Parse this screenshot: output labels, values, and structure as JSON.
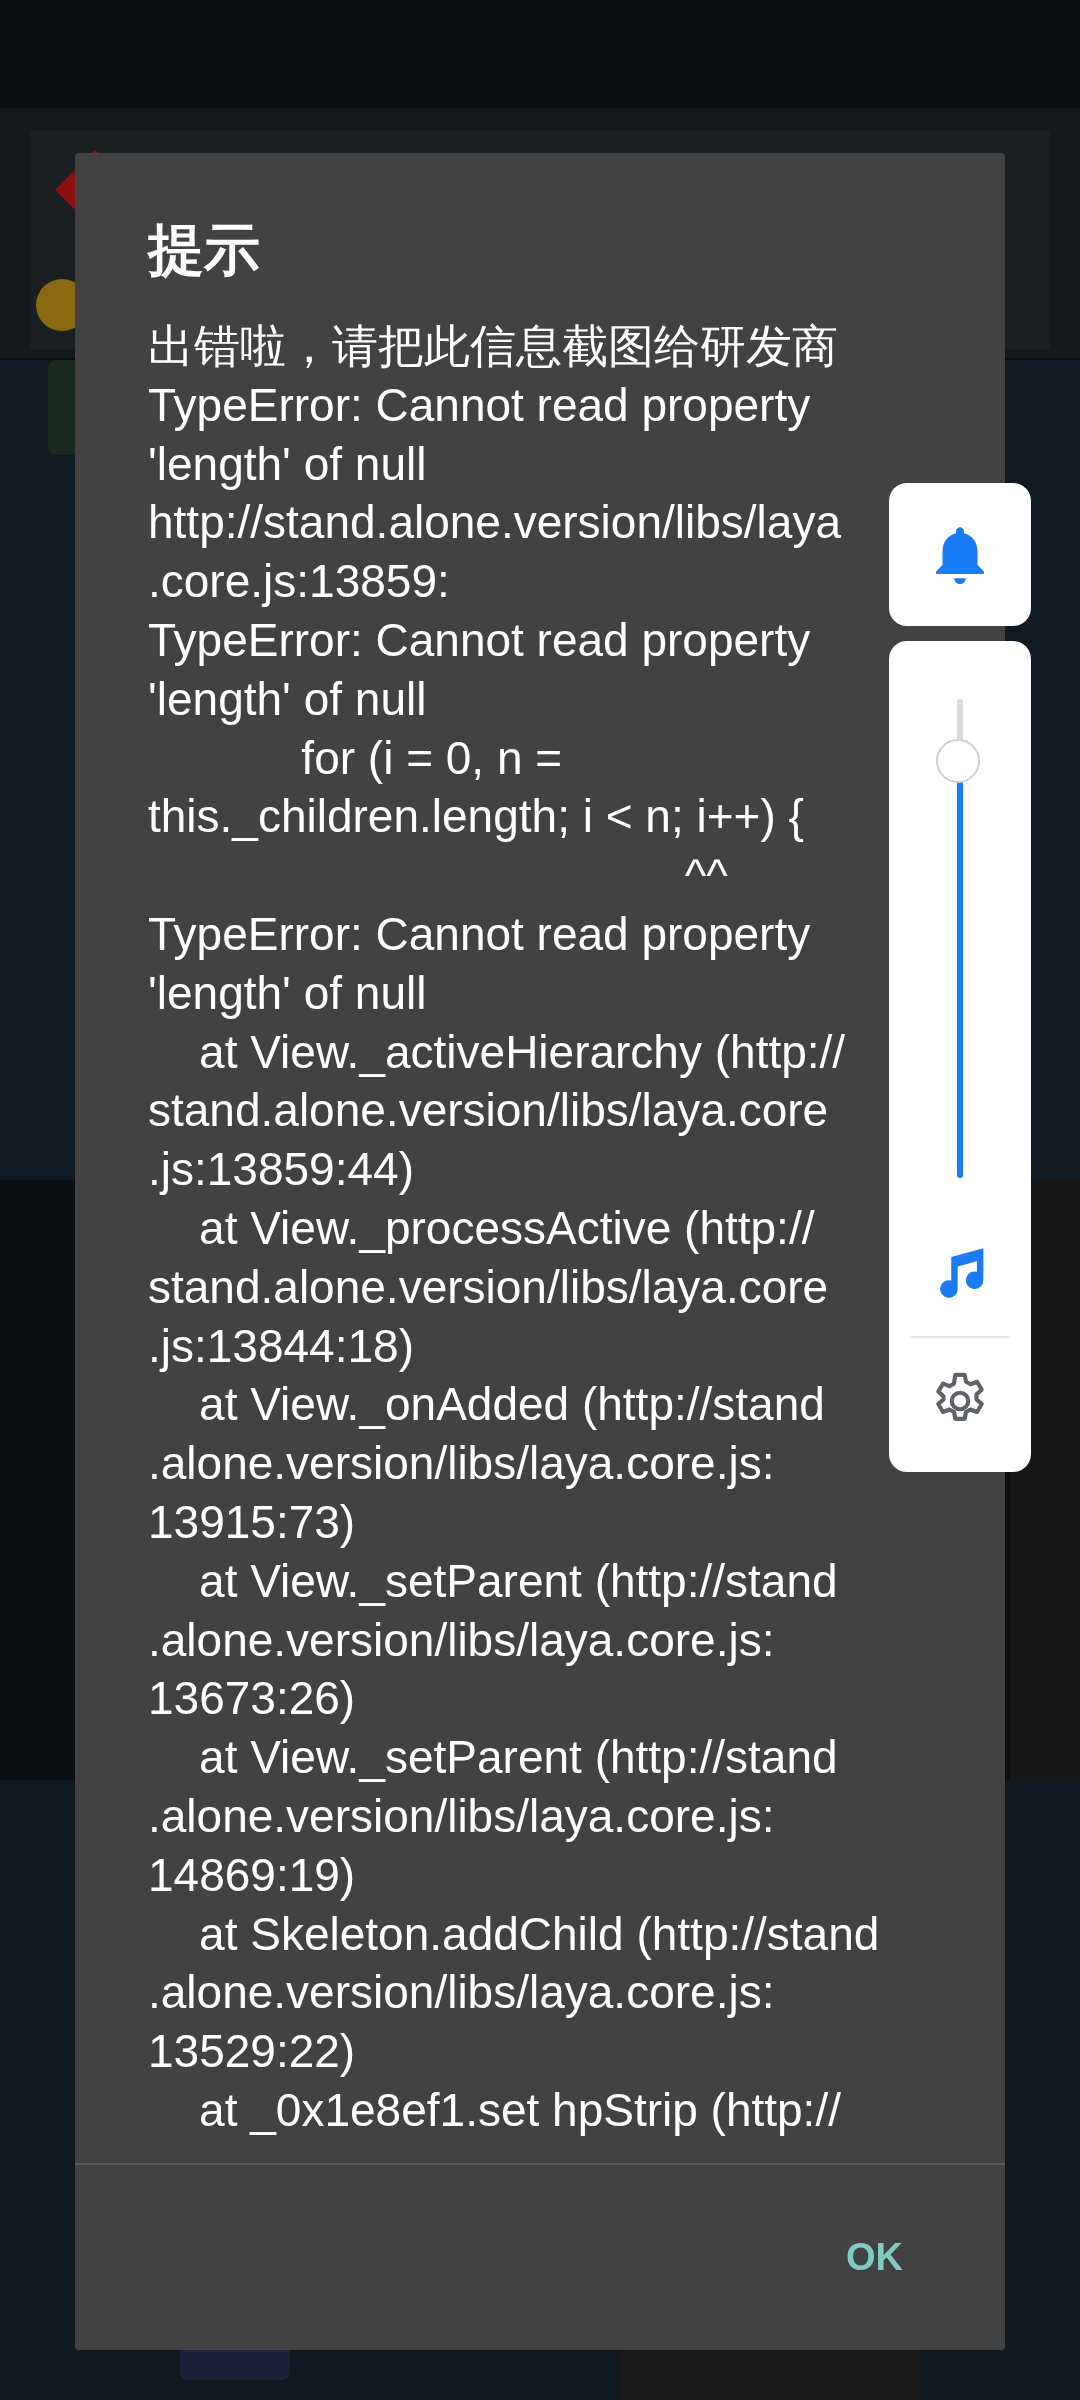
{
  "dialog": {
    "title": "提示",
    "message_lines": [
      "出错啦，请把此信息截图给研发商",
      "TypeError: Cannot read property",
      "'length' of null",
      "http://stand.alone.version/libs/laya",
      ".core.js:13859:",
      "TypeError: Cannot read property",
      "'length' of null",
      "            for (i = 0, n =",
      "this._children.length; i < n; i++) {",
      "                                          ^^",
      "TypeError: Cannot read property",
      "'length' of null",
      "    at View._activeHierarchy (http://",
      "stand.alone.version/libs/laya.core",
      ".js:13859:44)",
      "    at View._processActive (http://",
      "stand.alone.version/libs/laya.core",
      ".js:13844:18)",
      "    at View._onAdded (http://stand",
      ".alone.version/libs/laya.core.js:",
      "13915:73)",
      "    at View._setParent (http://stand",
      ".alone.version/libs/laya.core.js:",
      "13673:26)",
      "    at View._setParent (http://stand",
      ".alone.version/libs/laya.core.js:",
      "14869:19)",
      "    at Skeleton.addChild (http://stand",
      ".alone.version/libs/laya.core.js:",
      "13529:22)",
      "    at _0x1e8ef1.set hpStrip (http://"
    ],
    "buttons": [
      "OK"
    ]
  },
  "volume_panel": {
    "level": 0.87
  }
}
